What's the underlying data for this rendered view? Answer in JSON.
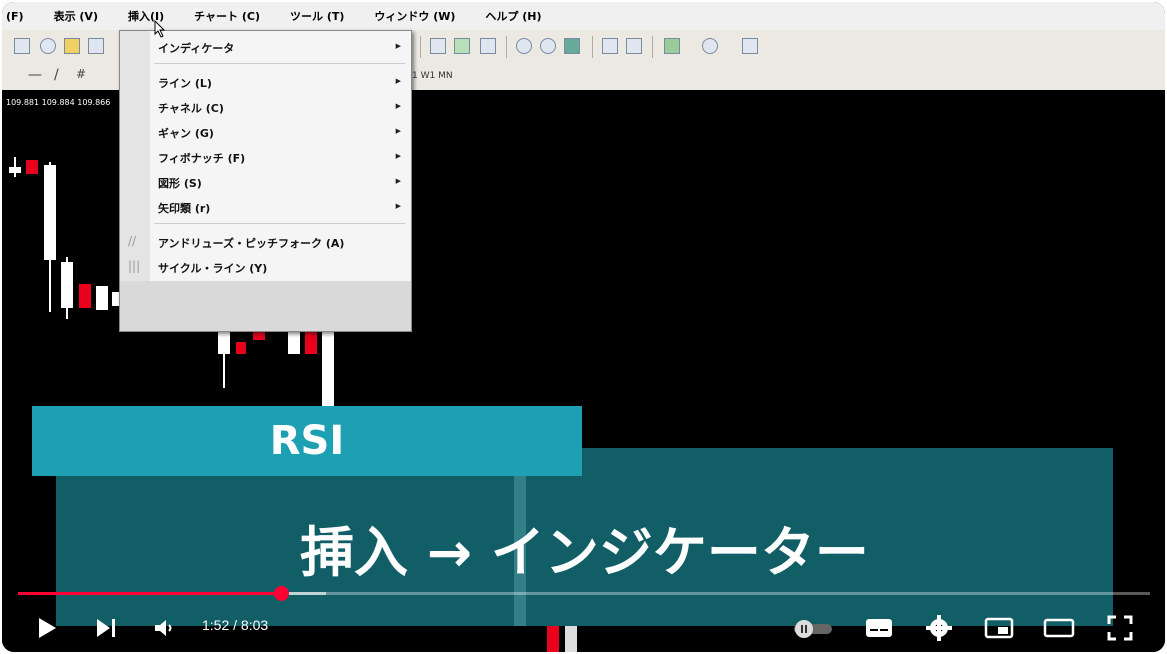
{
  "menubar": {
    "items": [
      "(F)",
      "表示 (V)",
      "挿入(I)",
      "チャート (C)",
      "ツール (T)",
      "ウィンドウ (W)",
      "ヘルプ (H)"
    ]
  },
  "toolbar": {
    "timeframes": "1  W1  MN"
  },
  "chart": {
    "price_labels": "109.881 109.884 109.866"
  },
  "insert_menu": {
    "items": [
      {
        "label": "インディケータ",
        "submenu": true
      },
      {
        "label": "ライン (L)",
        "submenu": true
      },
      {
        "label": "チャネル (C)",
        "submenu": true
      },
      {
        "label": "ギャン (G)",
        "submenu": true
      },
      {
        "label": "フィボナッチ (F)",
        "submenu": true
      },
      {
        "label": "図形 (S)",
        "submenu": true
      },
      {
        "label": "矢印類 (r)",
        "submenu": true
      },
      {
        "label": "アンドリューズ・ピッチフォーク (A)",
        "submenu": false
      },
      {
        "label": "サイクル・ライン (Y)",
        "submenu": false
      }
    ]
  },
  "overlay": {
    "title": "RSI",
    "subtitle": "挿入 → インジケーター"
  },
  "player": {
    "time": "1:52 / 8:03",
    "progress": 0.232,
    "buffered": 0.272,
    "accent": "#ff0033"
  }
}
